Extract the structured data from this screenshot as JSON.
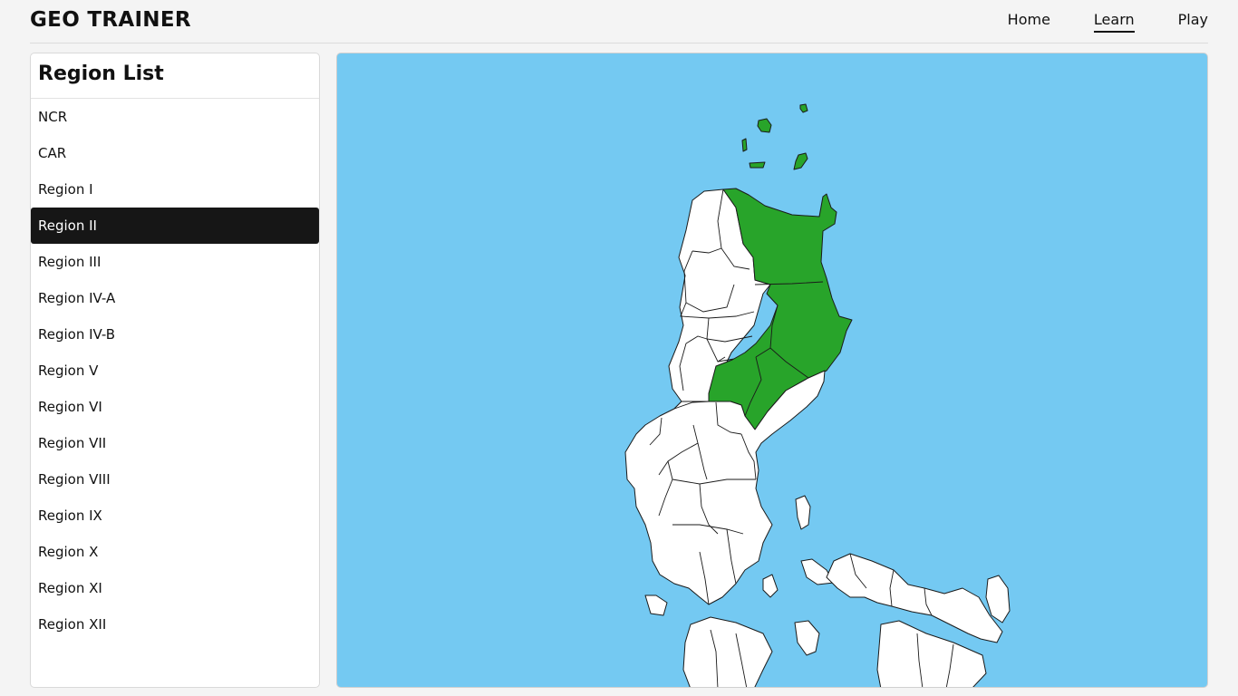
{
  "header": {
    "brand": "GEO TRAINER",
    "nav": [
      {
        "label": "Home",
        "active": false
      },
      {
        "label": "Learn",
        "active": true
      },
      {
        "label": "Play",
        "active": false
      }
    ]
  },
  "sidebar": {
    "title": "Region List",
    "selected": "Region II",
    "items": [
      {
        "label": "NCR"
      },
      {
        "label": "CAR"
      },
      {
        "label": "Region I"
      },
      {
        "label": "Region II"
      },
      {
        "label": "Region III"
      },
      {
        "label": "Region IV-A"
      },
      {
        "label": "Region IV-B"
      },
      {
        "label": "Region V"
      },
      {
        "label": "Region VI"
      },
      {
        "label": "Region VII"
      },
      {
        "label": "Region VIII"
      },
      {
        "label": "Region IX"
      },
      {
        "label": "Region X"
      },
      {
        "label": "Region XI"
      },
      {
        "label": "Region XII"
      }
    ]
  },
  "map": {
    "sea_color": "#74c9f2",
    "land_color": "#ffffff",
    "highlight_color": "#28a42a",
    "highlighted_region": "Region II"
  }
}
